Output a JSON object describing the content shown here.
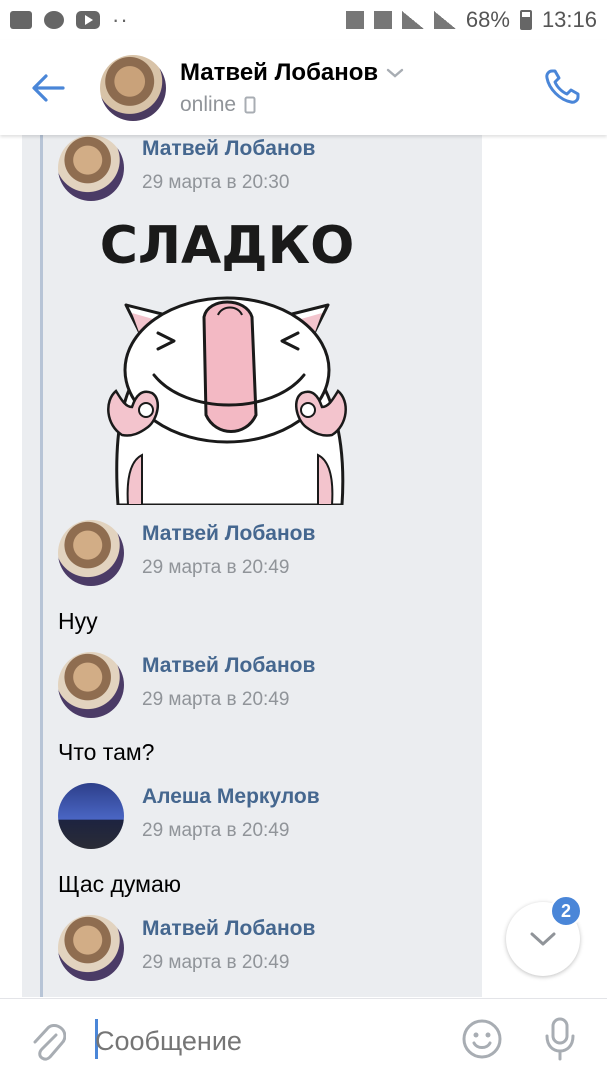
{
  "status_bar": {
    "battery": "68%",
    "time": "13:16"
  },
  "header": {
    "contact_name": "Матвей Лобанов",
    "status": "online",
    "accent_color": "#4a86d8"
  },
  "messages": [
    {
      "author": "Матвей Лобанов",
      "time": "29 марта в 20:30",
      "sticker_text": "СЛАДКО"
    },
    {
      "author": "Матвей Лобанов",
      "time": "29 марта в 20:49",
      "text": "Нуу"
    },
    {
      "author": "Матвей Лобанов",
      "time": "29 марта в 20:49",
      "text": "Что там?"
    },
    {
      "author": "Алеша Меркулов",
      "time": "29 марта в 20:49",
      "text": "Щас думаю"
    },
    {
      "author": "Матвей Лобанов",
      "time": "29 марта в 20:49"
    }
  ],
  "scroll_button": {
    "badge": "2"
  },
  "composer": {
    "placeholder": "Сообщение"
  },
  "icons": {
    "back": "arrow-left-icon",
    "call": "phone-icon",
    "attach": "paperclip-icon",
    "emoji": "smile-icon",
    "mic": "microphone-icon",
    "scroll": "chevron-down-icon"
  }
}
